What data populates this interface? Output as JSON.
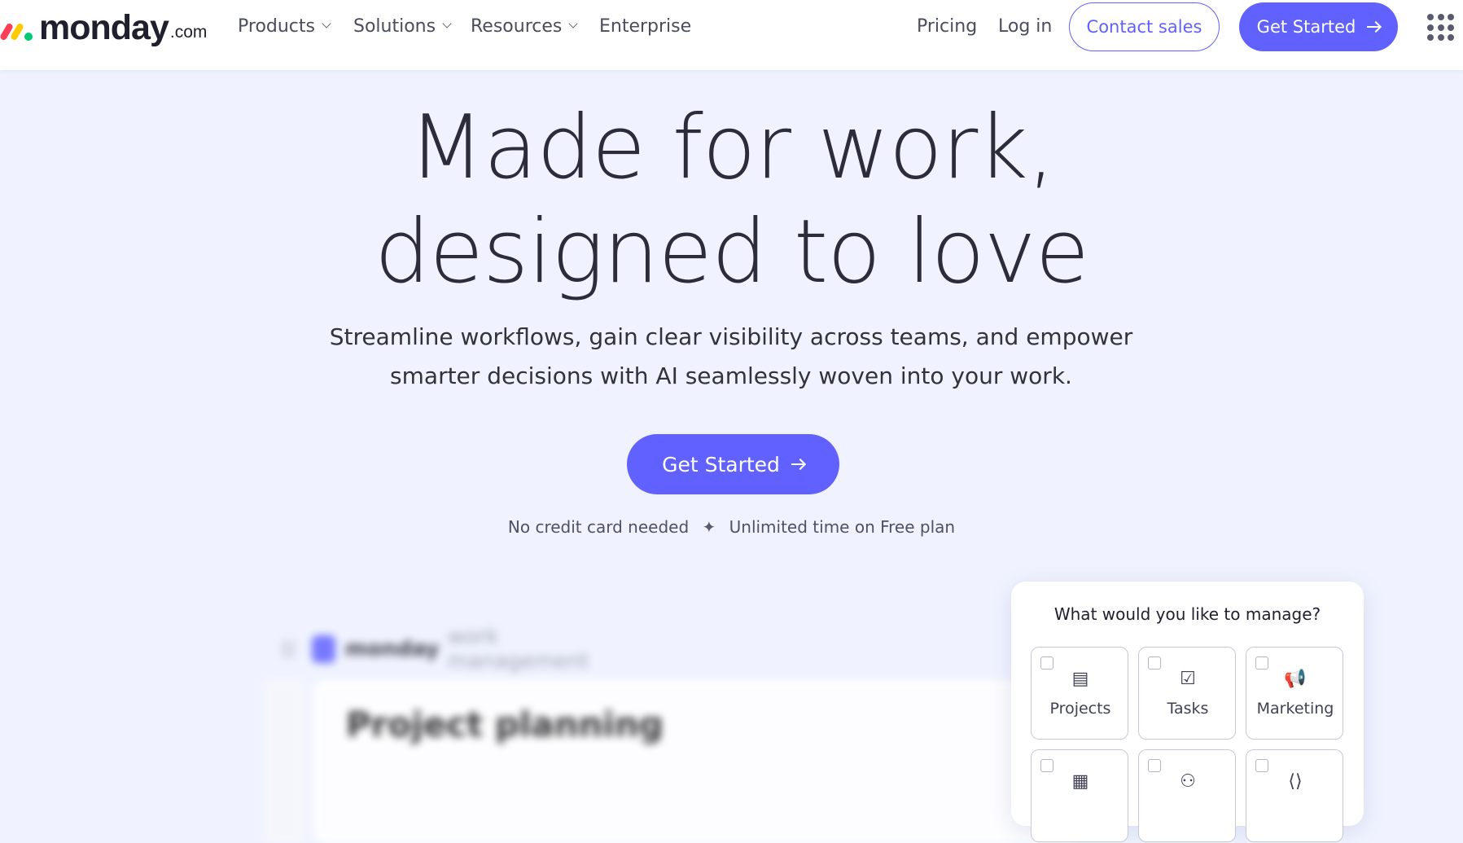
{
  "header": {
    "logo_word": "monday",
    "logo_suffix": ".com",
    "nav": {
      "products": "Products",
      "solutions": "Solutions",
      "resources": "Resources",
      "enterprise": "Enterprise",
      "pricing": "Pricing",
      "login": "Log in"
    },
    "contact_sales": "Contact sales",
    "get_started": "Get Started"
  },
  "hero": {
    "title_line1": "Made for work,",
    "title_line2": "designed to love",
    "subtitle_line1": "Streamline workflows, gain clear visibility across teams, and empower",
    "subtitle_line2": "smarter decisions with AI seamlessly woven into your work.",
    "cta": "Get Started",
    "note_left": "No credit card needed",
    "note_sep": "✦",
    "note_right": "Unlimited time on Free plan"
  },
  "preview": {
    "brand": "monday",
    "product": "work management",
    "board_title": "Project planning"
  },
  "manage": {
    "title": "What would you like to manage?",
    "options": [
      {
        "label": "Projects",
        "icon": "projects-icon"
      },
      {
        "label": "Tasks",
        "icon": "tasks-icon"
      },
      {
        "label": "Marketing",
        "icon": "megaphone-icon"
      },
      {
        "label": "",
        "icon": "document-icon"
      },
      {
        "label": "",
        "icon": "people-icon"
      },
      {
        "label": "",
        "icon": "code-icon"
      }
    ]
  },
  "colors": {
    "accent": "#6161ff",
    "background": "#f0f3ff"
  }
}
